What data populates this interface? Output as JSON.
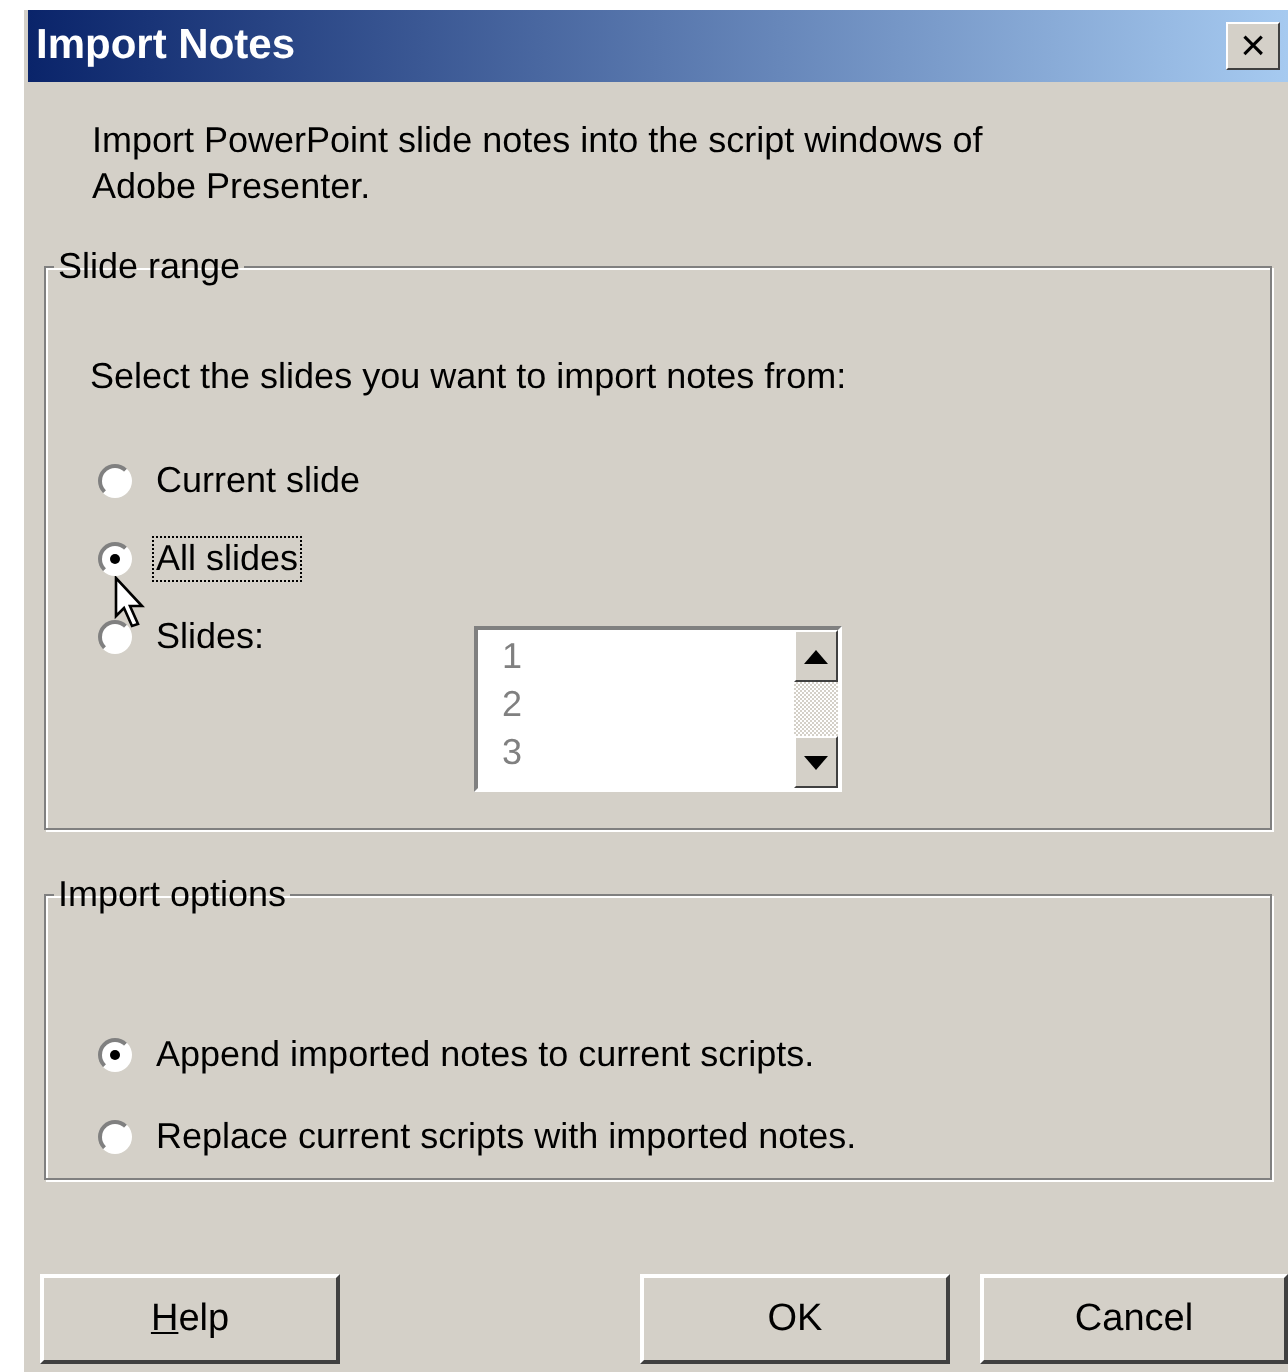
{
  "window": {
    "title": "Import Notes",
    "close_button": "×"
  },
  "description": "Import PowerPoint slide notes into the script windows of Adobe Presenter.",
  "slide_range": {
    "legend": "Slide range",
    "prompt": "Select the slides you want to import notes from:",
    "options": [
      {
        "label": "Current slide",
        "selected": false,
        "focused": false
      },
      {
        "label": "All slides",
        "selected": true,
        "focused": true
      },
      {
        "label": "Slides:",
        "selected": false,
        "focused": false
      }
    ],
    "slides_list": {
      "disabled": true,
      "items": [
        "1",
        "2",
        "3"
      ]
    }
  },
  "import_options": {
    "legend": "Import options",
    "options": [
      {
        "label": "Append imported notes to current scripts.",
        "selected": true
      },
      {
        "label": "Replace current scripts with imported notes.",
        "selected": false
      }
    ]
  },
  "buttons": [
    {
      "label": "Help",
      "first_letter_underlined": true
    },
    {
      "label": "OK"
    },
    {
      "label": "Cancel"
    }
  ]
}
